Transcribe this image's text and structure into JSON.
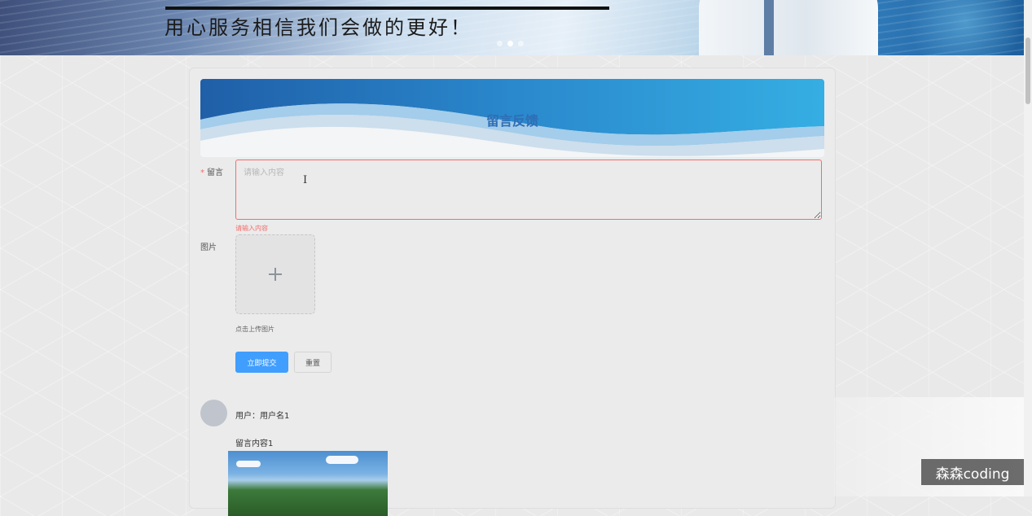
{
  "banner": {
    "slogan": "用心服务相信我们会做的更好！",
    "carousel_dots": 3,
    "active_dot": 2
  },
  "feedback": {
    "title": "留言反馈",
    "message_label": "留言",
    "message_placeholder": "请输入内容",
    "message_value": "",
    "message_error": "请输入内容",
    "image_label": "图片",
    "upload_tip": "点击上传图片",
    "submit_label": "立即提交",
    "reset_label": "重置"
  },
  "comment": {
    "user_text": "用户：用户名1",
    "content_text": "留言内容1"
  },
  "watermark": "森森coding",
  "colors": {
    "primary": "#409eff",
    "error": "#f56c6c",
    "title": "#2f6db5"
  }
}
